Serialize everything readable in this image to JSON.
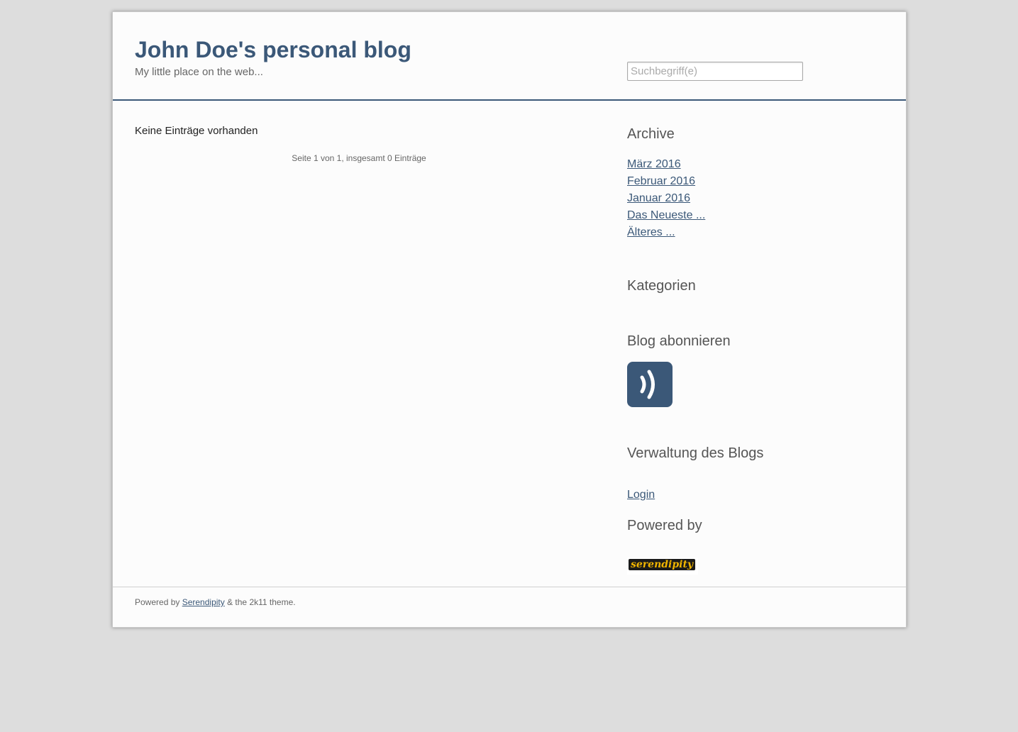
{
  "header": {
    "title": "John Doe's personal blog",
    "tagline": "My little place on the web...",
    "search_placeholder": "Suchbegriff(e)"
  },
  "main": {
    "no_entries": "Keine Einträge vorhanden",
    "pagination": "Seite 1 von 1, insgesamt 0 Einträge"
  },
  "sidebar": {
    "archive_title": "Archive",
    "archive_items": [
      "März 2016",
      "Februar 2016",
      "Januar 2016",
      "Das Neueste ...",
      "Älteres ..."
    ],
    "categories_title": "Kategorien",
    "subscribe_title": "Blog abonnieren",
    "feed_icon": "rss-feed-icon",
    "admin_title": "Verwaltung des Blogs",
    "login_label": "Login",
    "powered_title": "Powered by",
    "powered_badge": "serendipity"
  },
  "footer": {
    "prefix": "Powered by ",
    "link_label": "Serendipity",
    "suffix": " & the 2k11 theme."
  },
  "colors": {
    "accent": "#3b5878",
    "background": "#dddddd",
    "page": "#fcfcfc"
  }
}
